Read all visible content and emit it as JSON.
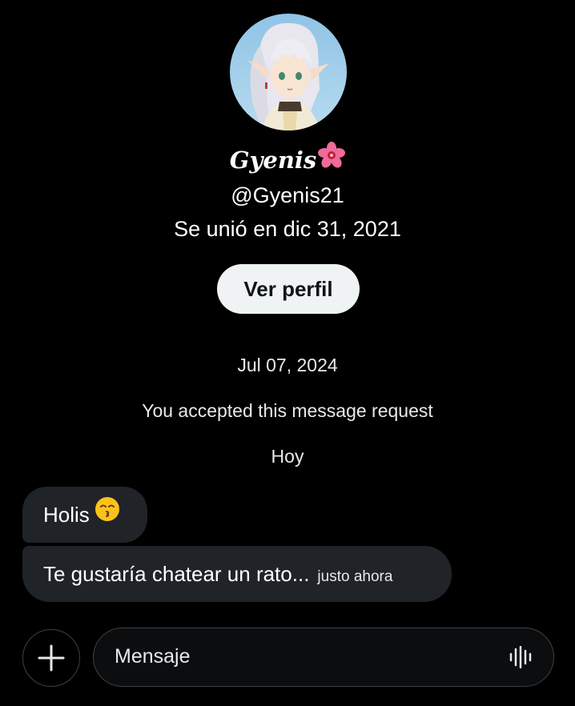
{
  "profile": {
    "avatar_icon": "anime-elf-avatar",
    "display_name": "Gyenis",
    "display_name_emoji": "hibiscus-flower-icon",
    "handle": "@Gyenis21",
    "joined": "Se unió en dic 31, 2021",
    "view_profile_label": "Ver perfil"
  },
  "conversation": {
    "date_header": "Jul 07, 2024",
    "system_message": "You accepted this message request",
    "today_label": "Hoy",
    "messages": [
      {
        "text": "Holis",
        "emoji": "kissing-face-icon",
        "timestamp": ""
      },
      {
        "text": "Te gustaría chatear un rato...",
        "emoji": "",
        "timestamp": "justo ahora"
      }
    ]
  },
  "composer": {
    "add_icon": "plus-icon",
    "placeholder": "Mensaje",
    "value": "",
    "voice_icon": "voice-wave-icon"
  },
  "colors": {
    "background": "#000000",
    "bubble": "#202327",
    "button_bg": "#eff3f4",
    "button_text": "#0f1419",
    "border": "#3e4144"
  }
}
